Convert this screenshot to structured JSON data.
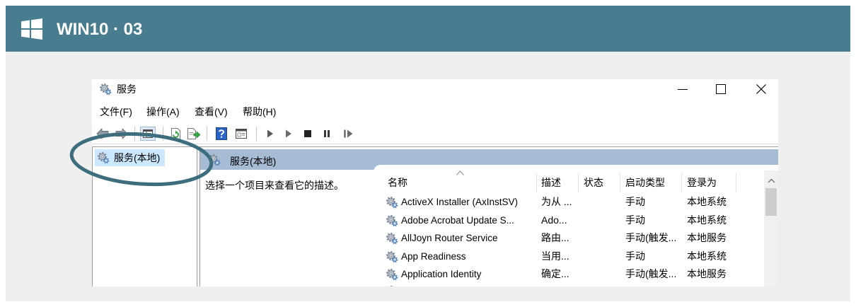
{
  "header": {
    "title": "WIN10 · 03",
    "logo_icon": "windows-logo-icon"
  },
  "window": {
    "title": "服务",
    "title_icon": "services-gear-icon",
    "controls": [
      "minimize-icon",
      "maximize-icon",
      "close-icon"
    ],
    "menu": [
      {
        "label": "文件(F)"
      },
      {
        "label": "操作(A)"
      },
      {
        "label": "查看(V)"
      },
      {
        "label": "帮助(H)"
      }
    ],
    "toolbar": [
      "back-arrow-icon",
      "forward-arrow-icon",
      "console-tree-toggle-icon",
      "refresh-icon",
      "export-list-icon",
      "help-icon",
      "properties-icon",
      "start-service-icon",
      "start-service-alt-icon",
      "stop-service-icon",
      "pause-service-icon",
      "restart-service-icon"
    ],
    "tree": {
      "selected": "服务(本地)"
    },
    "panel": {
      "title": "服务(本地)",
      "description": "选择一个项目来查看它的描述。"
    },
    "services": {
      "columns": {
        "name": "名称",
        "description": "描述",
        "status": "状态",
        "startup_type": "启动类型",
        "log_on_as": "登录为"
      },
      "sort_indicator_icon": "sort-ascending-icon",
      "rows": [
        {
          "name": "ActiveX Installer (AxInstSV)",
          "description": "为从 ...",
          "status": "",
          "startup_type": "手动",
          "log_on_as": "本地系统"
        },
        {
          "name": "Adobe Acrobat Update S...",
          "description": "Ado...",
          "status": "",
          "startup_type": "手动",
          "log_on_as": "本地系统"
        },
        {
          "name": "AllJoyn Router Service",
          "description": "路由...",
          "status": "",
          "startup_type": "手动(触发...",
          "log_on_as": "本地服务"
        },
        {
          "name": "App Readiness",
          "description": "当用...",
          "status": "",
          "startup_type": "手动",
          "log_on_as": "本地系统"
        },
        {
          "name": "Application Identity",
          "description": "确定...",
          "status": "",
          "startup_type": "手动(触发...",
          "log_on_as": "本地服务"
        }
      ]
    }
  },
  "colors": {
    "header_bg": "#477d8f",
    "frame_bg": "#efefef",
    "annotation": "#3d6e7e",
    "selection": "#cce8ff",
    "panel_header": "#a6bbd4"
  }
}
